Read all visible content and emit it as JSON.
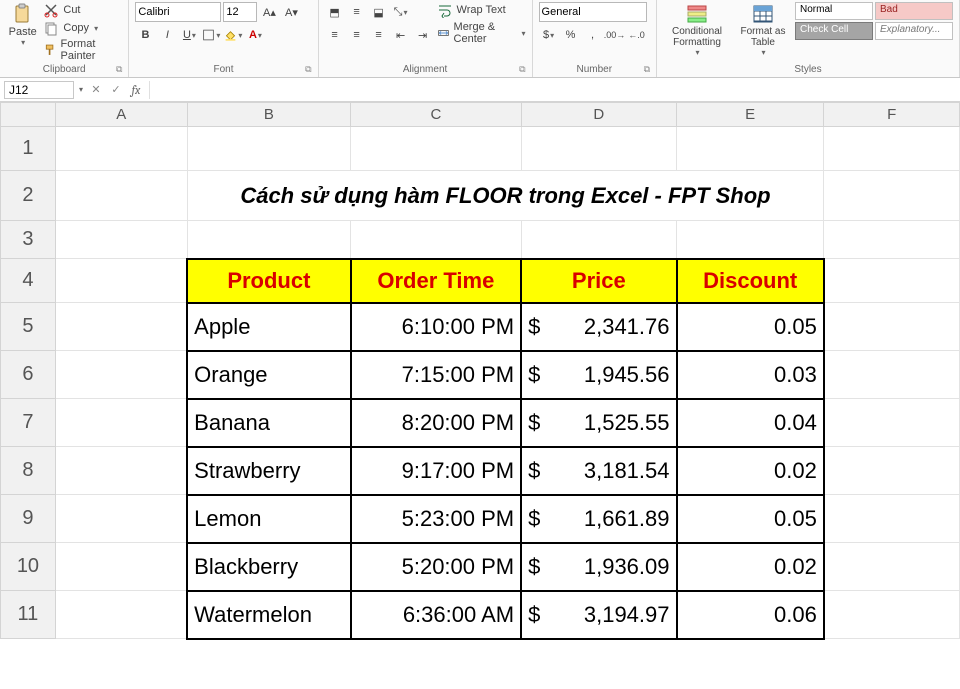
{
  "ribbon": {
    "clipboard": {
      "label": "Clipboard",
      "paste": "Paste",
      "cut": "Cut",
      "copy": "Copy",
      "format_painter": "Format Painter"
    },
    "font": {
      "label": "Font",
      "family": "Calibri",
      "size": "12"
    },
    "alignment": {
      "label": "Alignment",
      "wrap_text": "Wrap Text",
      "merge_center": "Merge & Center"
    },
    "number": {
      "label": "Number",
      "format": "General"
    },
    "styles": {
      "label": "Styles",
      "cond_fmt": "Conditional Formatting",
      "format_table": "Format as Table",
      "normal": "Normal",
      "bad": "Bad",
      "check_cell": "Check Cell",
      "explanatory": "Explanatory..."
    }
  },
  "namebox": "J12",
  "formula": "",
  "sheet": {
    "columns": [
      "A",
      "B",
      "C",
      "D",
      "E",
      "F"
    ],
    "rows": [
      "1",
      "2",
      "3",
      "4",
      "5",
      "6",
      "7",
      "8",
      "9",
      "10",
      "11"
    ],
    "title": "Cách sử dụng hàm FLOOR trong Excel - FPT Shop",
    "headers": {
      "product": "Product",
      "order_time": "Order Time",
      "price": "Price",
      "discount": "Discount"
    },
    "data": [
      {
        "product": "Apple",
        "order_time": "6:10:00 PM",
        "price": "2,341.76",
        "discount": "0.05"
      },
      {
        "product": "Orange",
        "order_time": "7:15:00 PM",
        "price": "1,945.56",
        "discount": "0.03"
      },
      {
        "product": "Banana",
        "order_time": "8:20:00 PM",
        "price": "1,525.55",
        "discount": "0.04"
      },
      {
        "product": "Strawberry",
        "order_time": "9:17:00 PM",
        "price": "3,181.54",
        "discount": "0.02"
      },
      {
        "product": "Lemon",
        "order_time": "5:23:00 PM",
        "price": "1,661.89",
        "discount": "0.05"
      },
      {
        "product": "Blackberry",
        "order_time": "5:20:00 PM",
        "price": "1,936.09",
        "discount": "0.02"
      },
      {
        "product": "Watermelon",
        "order_time": "6:36:00 AM",
        "price": "3,194.97",
        "discount": "0.06"
      }
    ],
    "currency_symbol": "$"
  }
}
